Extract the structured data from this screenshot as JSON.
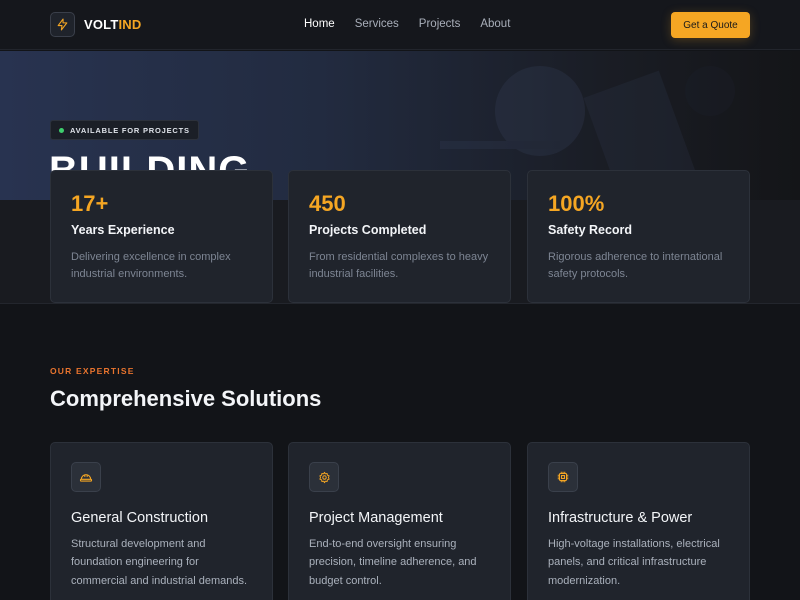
{
  "brand": {
    "part1": "VOLT",
    "part2": "IND",
    "accent": "#f5a623"
  },
  "nav": {
    "links": [
      "Home",
      "Services",
      "Projects",
      "About"
    ],
    "active": "Home",
    "cta": "Get a Quote"
  },
  "hero": {
    "badge": "AVAILABLE FOR PROJECTS",
    "badge_dot_color": "#3ecf6e",
    "title": "BUILDING"
  },
  "stats": [
    {
      "value": "17+",
      "label": "Years Experience",
      "desc": "Delivering excellence in complex industrial environments."
    },
    {
      "value": "450",
      "label": "Projects Completed",
      "desc": "From residential complexes to heavy industrial facilities."
    },
    {
      "value": "100%",
      "label": "Safety Record",
      "desc": "Rigorous adherence to international safety protocols."
    }
  ],
  "expertise": {
    "eyebrow": "OUR EXPERTISE",
    "eyebrow_color": "#e8742e",
    "title": "Comprehensive Solutions",
    "services": [
      {
        "icon": "hard-hat-icon",
        "title": "General Construction",
        "desc": "Structural development and foundation engineering for commercial and industrial demands."
      },
      {
        "icon": "gear-icon",
        "title": "Project Management",
        "desc": "End-to-end oversight ensuring precision, timeline adherence, and budget control."
      },
      {
        "icon": "chip-icon",
        "title": "Infrastructure & Power",
        "desc": "High-voltage installations, electrical panels, and critical infrastructure modernization."
      }
    ]
  }
}
